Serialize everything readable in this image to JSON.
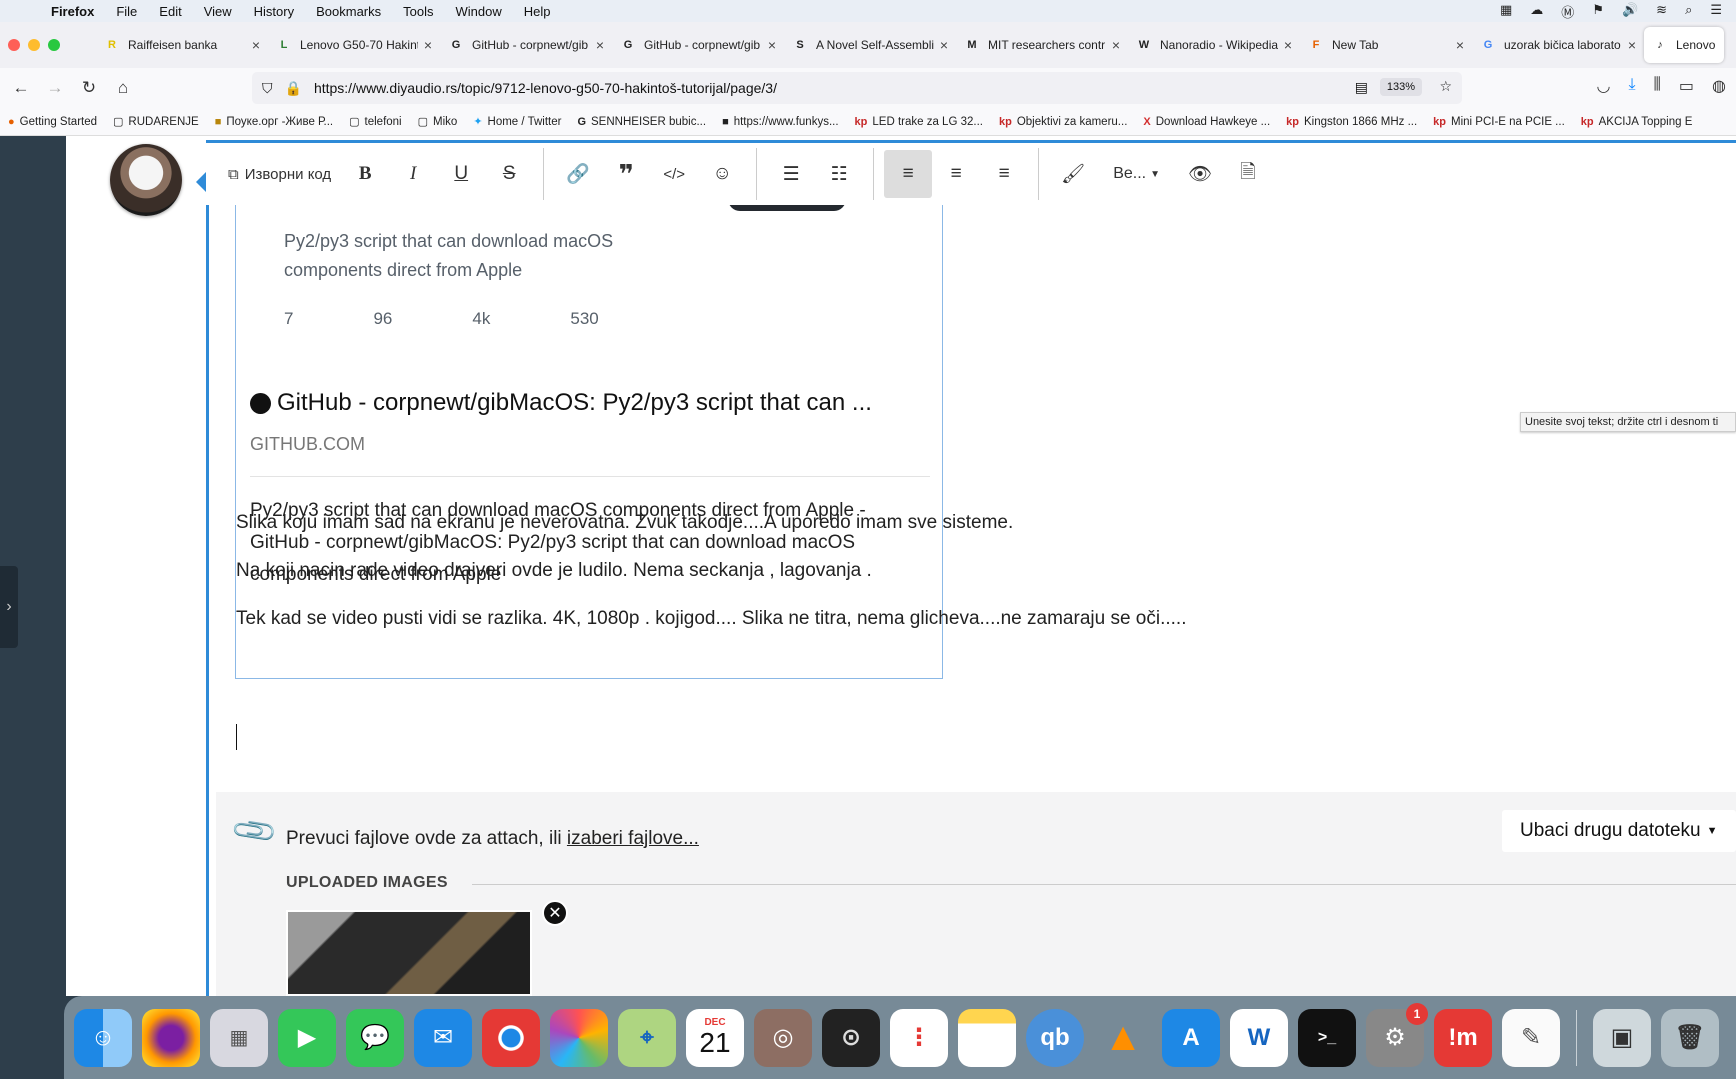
{
  "menubar": {
    "app": "Firefox",
    "items": [
      "File",
      "Edit",
      "View",
      "History",
      "Bookmarks",
      "Tools",
      "Window",
      "Help"
    ]
  },
  "tabs": [
    {
      "title": "Raiffeisen banka",
      "icon": "R"
    },
    {
      "title": "Lenovo G50-70 Hakint",
      "icon": "L"
    },
    {
      "title": "GitHub - corpnewt/gib",
      "icon": "G"
    },
    {
      "title": "GitHub - corpnewt/gib",
      "icon": "G"
    },
    {
      "title": "A Novel Self-Assembli",
      "icon": "S"
    },
    {
      "title": "MIT researchers contr",
      "icon": "M"
    },
    {
      "title": "Nanoradio - Wikipedia",
      "icon": "W"
    },
    {
      "title": "New Tab",
      "icon": "F"
    },
    {
      "title": "uzorak bičica laborato",
      "icon": "G"
    },
    {
      "title": "Lenovo G",
      "icon": "♪"
    }
  ],
  "nav": {
    "url": "https://www.diyaudio.rs/topic/9712-lenovo-g50-70-hakintoš-tutorijal/page/3/",
    "zoom": "133%"
  },
  "bookmarks": [
    {
      "label": "Getting Started",
      "icon": "●"
    },
    {
      "label": "RUDARENJE",
      "icon": "▢"
    },
    {
      "label": "Поуке.орг -Живе Р...",
      "icon": "■"
    },
    {
      "label": "telefoni",
      "icon": "▢"
    },
    {
      "label": "Miko",
      "icon": "▢"
    },
    {
      "label": "Home / Twitter",
      "icon": "✦"
    },
    {
      "label": "SENNHEISER bubic...",
      "icon": "G"
    },
    {
      "label": "https://www.funkys...",
      "icon": "■"
    },
    {
      "label": "LED trake za LG 32...",
      "icon": "kp"
    },
    {
      "label": "Objektivi za kameru...",
      "icon": "kp"
    },
    {
      "label": "Download Hawkeye ...",
      "icon": "X"
    },
    {
      "label": "Kingston 1866 MHz ...",
      "icon": "kp"
    },
    {
      "label": "Mini PCI-E na PCIE ...",
      "icon": "kp"
    },
    {
      "label": "AKCIJA Topping E",
      "icon": "kp"
    }
  ],
  "toolbar": {
    "source_label": "Изворни код",
    "more_label": "Ве..."
  },
  "preview": {
    "gh_desc": "Py2/py3 script that can download macOS components direct from Apple",
    "gh_stats": [
      "7",
      "96",
      "4k",
      "530"
    ],
    "title": "GitHub - corpnewt/gibMacOS: Py2/py3 script that can ...",
    "domain": "GITHUB.COM",
    "description": "Py2/py3 script that can download macOS components direct from Apple - GitHub - corpnewt/gibMacOS: Py2/py3 script that can download macOS components direct from Apple"
  },
  "paragraphs": [
    "Slika koju imam sad na ekranu je neverovatna. Zvuk takodje....A uporedo imam sve sisteme.",
    "Na koji nacin rade video drajveri ovde je ludilo. Nema seckanja , lagovanja .",
    "Tek kad se video pusti vidi se razlika. 4K, 1080p . kojigod.... Slika ne titra, nema glicheva....ne zamaraju se oči....."
  ],
  "tooltip": "Unesite svoj tekst; držite ctrl i desnom ti",
  "attach": {
    "drop_text": "Prevuci fajlove ovde za attach, ili ",
    "choose_link": "izaberi fajlove...",
    "insert_button": "Ubaci drugu datoteku",
    "uploaded_heading": "UPLOADED IMAGES"
  },
  "dock": {
    "calendar_month": "DEC",
    "calendar_day": "21",
    "badge": "1"
  }
}
